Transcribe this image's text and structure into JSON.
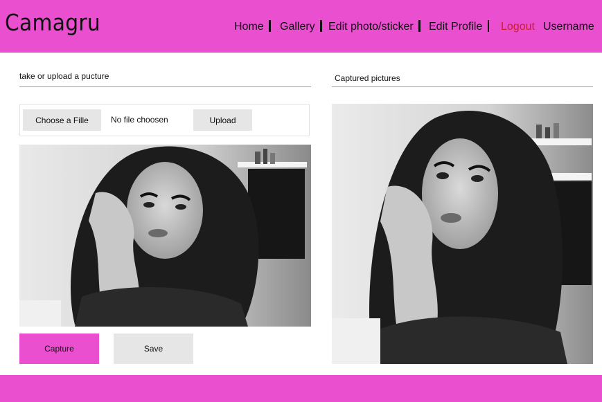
{
  "app": {
    "brand": "Camagru"
  },
  "nav": {
    "home": "Home",
    "gallery": "Gallery",
    "edit_photo": "Edit photo/sticker",
    "edit_profile": "Edit Profile",
    "logout": "Logout",
    "username": "Username"
  },
  "left_panel": {
    "title": "take or upload a  pucture",
    "choose_file_label": "Choose a Fille",
    "file_status": "No file choosen",
    "upload_label": "Upload",
    "capture_label": "Capture",
    "save_label": "Save"
  },
  "right_panel": {
    "title": "Captured pictures"
  },
  "colors": {
    "accent": "#ea4fd0",
    "logout": "#cc1d2b",
    "button_gray": "#e6e6e6"
  }
}
